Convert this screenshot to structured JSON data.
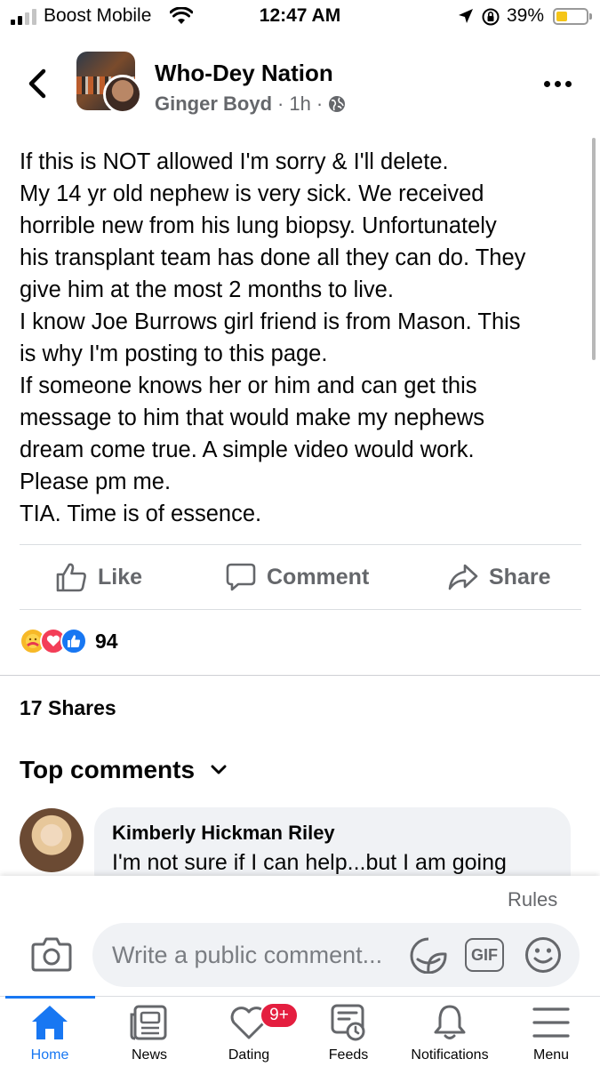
{
  "status_bar": {
    "carrier": "Boost Mobile",
    "time": "12:47 AM",
    "battery_percent": "39%",
    "battery_level": 0.39,
    "icons": [
      "signal-icon",
      "wifi-icon",
      "location-arrow-icon",
      "rotation-lock-icon",
      "battery-icon"
    ]
  },
  "header": {
    "group_name": "Who-Dey Nation",
    "author": "Ginger Boyd",
    "time_ago": "1h",
    "separator": "·",
    "icons": [
      "back-icon",
      "group-avatar",
      "user-avatar",
      "globe-icon",
      "more-icon"
    ]
  },
  "post": {
    "lines": [
      "If this is NOT allowed I'm sorry & I'll delete.",
      "My 14 yr old nephew is very sick. We received",
      "horrible new from his lung biopsy. Unfortunately",
      "his transplant team has done all they can do. They",
      "give him at the most 2 months to live.",
      "I know Joe Burrows girl friend is from Mason. This",
      "is why I'm posting to this page.",
      "If someone knows her or him and can get this",
      "message to him that would make my nephews",
      "dream come true. A simple video would work.",
      "Please pm me.",
      "TIA. Time is of essence."
    ]
  },
  "actions": {
    "like": "Like",
    "comment": "Comment",
    "share": "Share"
  },
  "reactions": {
    "types": [
      "care",
      "love",
      "like"
    ],
    "count": "94"
  },
  "shares_text": "17 Shares",
  "comments": {
    "heading": "Top comments",
    "items": [
      {
        "name": "Kimberly Hickman Riley",
        "text": "I'm not sure if I can help...but I am going"
      }
    ]
  },
  "composer": {
    "rules_label": "Rules",
    "placeholder": "Write a public comment...",
    "gif_label": "GIF"
  },
  "nav": {
    "items": [
      {
        "label": "Home",
        "icon": "home-icon"
      },
      {
        "label": "News",
        "icon": "news-icon"
      },
      {
        "label": "Dating",
        "icon": "dating-icon",
        "badge": "9+"
      },
      {
        "label": "Feeds",
        "icon": "feeds-icon"
      },
      {
        "label": "Notifications",
        "icon": "bell-icon"
      },
      {
        "label": "Menu",
        "icon": "menu-icon"
      }
    ]
  },
  "colors": {
    "accent": "#1877f2",
    "text": "#050505",
    "secondary_text": "#65676b",
    "badge": "#e41e3f",
    "bubble": "#f0f2f5"
  }
}
